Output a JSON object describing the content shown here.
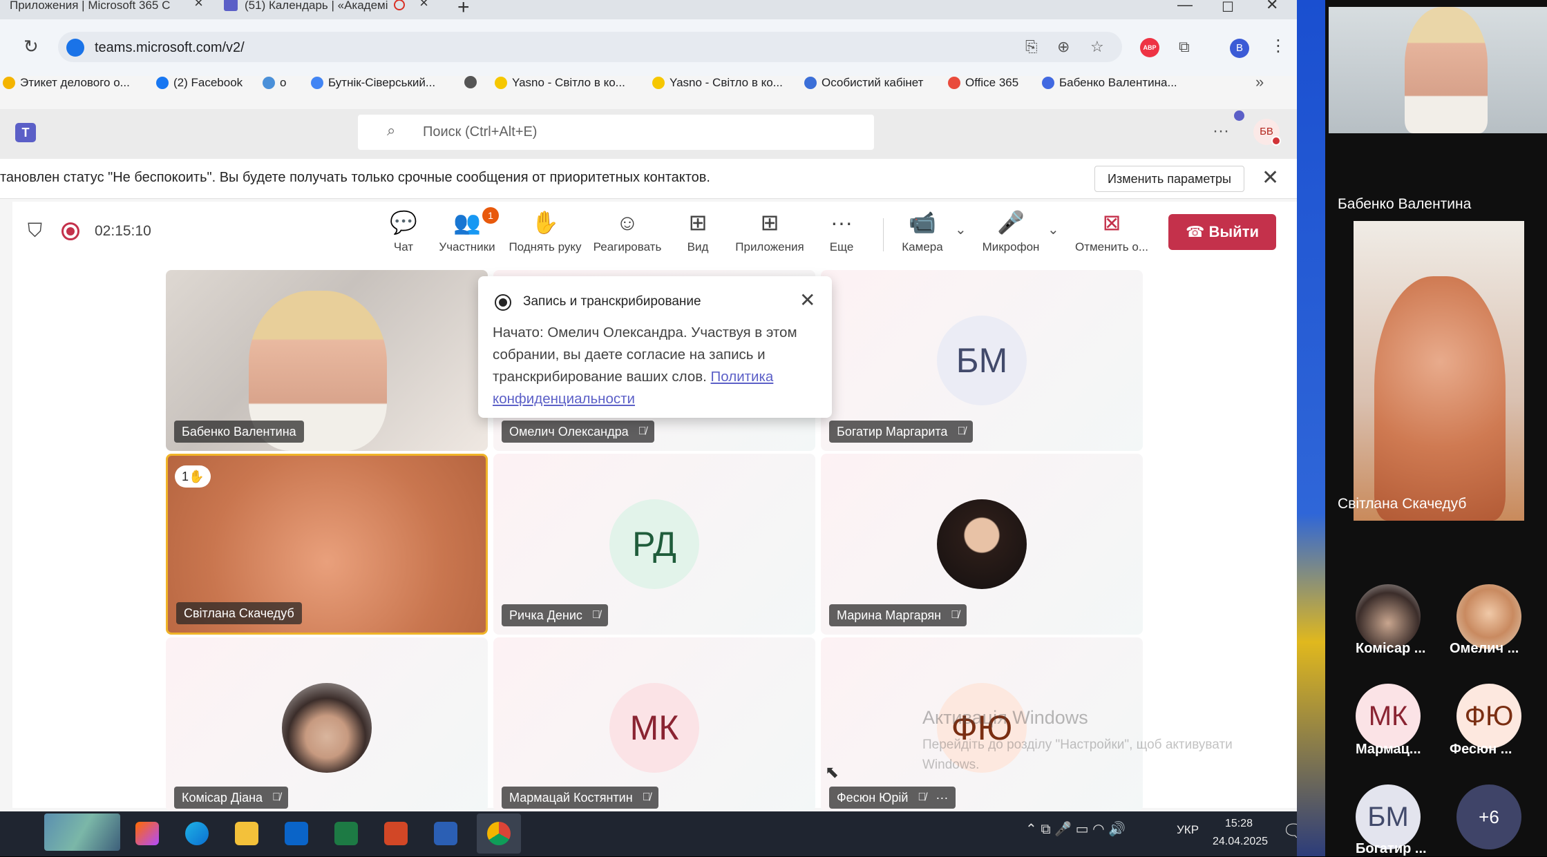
{
  "browser": {
    "tabs": [
      {
        "label": "Приложения | Microsoft 365 C"
      },
      {
        "label": "(51) Календарь | «Академі"
      }
    ],
    "url": "teams.microsoft.com/v2/",
    "profile_initial": "B",
    "bookmarks": [
      {
        "label": "Этикет делового о...",
        "color": "#f4b400"
      },
      {
        "label": "(2) Facebook",
        "color": "#1877f2"
      },
      {
        "label": "о",
        "color": "#4a90d9"
      },
      {
        "label": "Бутнік-Сіверський...",
        "color": "#4285f4"
      },
      {
        "label": "",
        "color": "#555555"
      },
      {
        "label": "Yasno - Світло в ко...",
        "color": "#f6c700"
      },
      {
        "label": "Yasno - Світло в ко...",
        "color": "#f6c700"
      },
      {
        "label": "Особистий кабінет",
        "color": "#3b6fd8"
      },
      {
        "label": "Office 365",
        "color": "#e94b3c"
      },
      {
        "label": "Бабенко Валентина...",
        "color": "#4169e1"
      }
    ]
  },
  "teams": {
    "search_placeholder": "Поиск (Ctrl+Alt+E)",
    "user_initials": "БВ",
    "banner_text": "тановлен статус \"Не беспокоить\". Вы будете получать только срочные сообщения от приоритетных контактов.",
    "banner_button": "Изменить параметры"
  },
  "call": {
    "timer": "02:15:10",
    "controls": {
      "chat": "Чат",
      "participants": "Участники",
      "participants_badge": "1",
      "raise_hand": "Поднять руку",
      "react": "Реагировать",
      "view": "Вид",
      "apps": "Приложения",
      "more": "Еще",
      "camera": "Камера",
      "mic": "Микрофон",
      "stop": "Отменить о...",
      "leave": "Выйти"
    },
    "popup": {
      "title": "Запись и транскрибирование",
      "body": "Начато: Омелич Олександра. Участвуя в этом собрании, вы даете согласие на запись и транскрибирование ваших слов. ",
      "link": "Политика конфиденциальности"
    },
    "tiles": [
      {
        "name": "Бабенко Валентина"
      },
      {
        "name": "Омелич Олександра"
      },
      {
        "name": "Богатир Маргарита",
        "initials": "БМ"
      },
      {
        "name": "Світлана Скачедуб",
        "hand": "1"
      },
      {
        "name": "Ричка Денис",
        "initials": "РД"
      },
      {
        "name": "Марина Маргарян"
      },
      {
        "name": "Комісар Діана"
      },
      {
        "name": "Мармацай Костянтин",
        "initials": "МК"
      },
      {
        "name": "Фесюн Юрій",
        "initials": "ФЮ"
      }
    ]
  },
  "watermark": {
    "title": "Активація Windows",
    "text": "Перейдіть до розділу \"Настройки\", щоб активувати Windows."
  },
  "taskbar": {
    "lang": "УКР",
    "time": "15:28",
    "date": "24.04.2025"
  },
  "side_panel": {
    "video1_name": "Бабенко Валентина",
    "video2_name": "Світлана Скачедуб",
    "participants": [
      {
        "name": "Комісар ..."
      },
      {
        "name": "Омелич ..."
      },
      {
        "name": "Мармац...",
        "initials": "МК"
      },
      {
        "name": "Фесюн ...",
        "initials": "ФЮ"
      },
      {
        "name": "Богатир ...",
        "initials": "БМ"
      },
      {
        "name": "",
        "initials": "+6"
      }
    ]
  }
}
